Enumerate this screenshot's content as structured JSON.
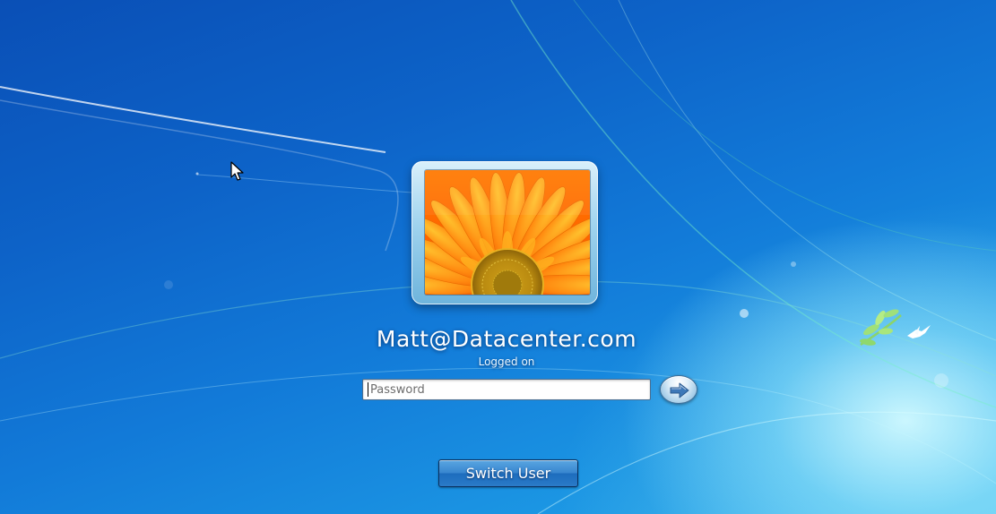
{
  "user": {
    "name": "Matt@Datacenter.com",
    "status": "Logged on",
    "avatar_icon": "orange-gerbera-flower-picture"
  },
  "login": {
    "password_placeholder": "Password",
    "password_value": "",
    "submit_icon": "right-arrow-icon"
  },
  "actions": {
    "switch_user_label": "Switch User"
  },
  "colors": {
    "background_top": "#0a4fb6",
    "background_bottom_right": "#c8f4ff",
    "button_blue": "#2a7bc8"
  }
}
